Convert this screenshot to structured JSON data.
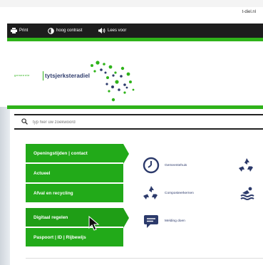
{
  "site": {
    "domain": "t-diel.nl"
  },
  "toolbar": {
    "print_label": "Print",
    "contrast_label": "hoog contrast",
    "read_label": "Lees voor"
  },
  "logo": {
    "small_text": "gemeente",
    "name": "tytsjerksteradiel"
  },
  "search": {
    "placeholder": "typ hier uw zoekwoord"
  },
  "nav": {
    "items": [
      {
        "label": "Openingstijden | contact"
      },
      {
        "label": "Actueel"
      },
      {
        "label": "Afval en recycling"
      },
      {
        "label": "Digitaal regelen"
      },
      {
        "label": "Paspoort | ID | Rijbewijs"
      }
    ]
  },
  "quicklinks": {
    "col1": [
      {
        "label": "Gemeentehuis"
      },
      {
        "label": "Composteerkernen"
      },
      {
        "label": "Melding doen"
      }
    ]
  },
  "colors": {
    "brand_green": "#2fb31a",
    "nav_green": "#22aa19",
    "navy": "#2c3a6b",
    "bar_black": "#1d1d1d"
  }
}
